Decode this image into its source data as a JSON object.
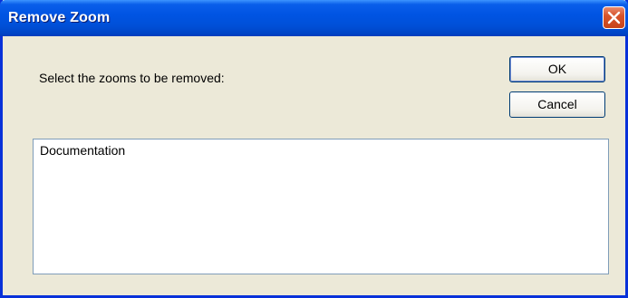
{
  "window": {
    "title": "Remove Zoom"
  },
  "dialog": {
    "prompt": "Select the zooms to be removed:",
    "ok_label": "OK",
    "cancel_label": "Cancel",
    "items": [
      "Documentation"
    ]
  },
  "colors": {
    "titlebar": "#0054e3",
    "close_button": "#d7542c",
    "window_bg": "#ece9d8",
    "list_border": "#7f9db9"
  },
  "icons": {
    "close": "close-icon"
  }
}
